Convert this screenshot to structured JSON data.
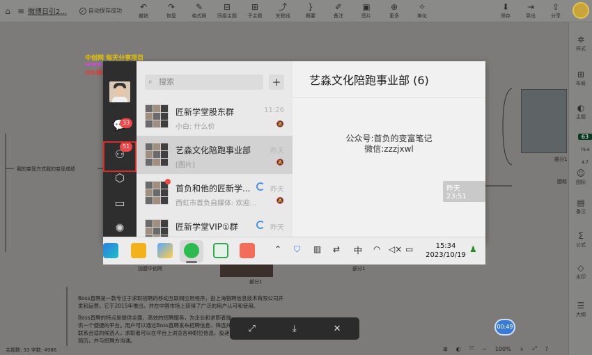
{
  "toolbar": {
    "doc_title": "微博日引2...",
    "autosave": "自动保存成功",
    "tools": [
      {
        "icon": "undo-icon",
        "glyph": "↶",
        "label": "撤销"
      },
      {
        "icon": "redo-icon",
        "glyph": "↷",
        "label": "恢复"
      },
      {
        "icon": "format-painter-icon",
        "glyph": "✎",
        "label": "格式刷"
      },
      {
        "icon": "sibling-topic-icon",
        "glyph": "⊟",
        "label": "同级主题"
      },
      {
        "icon": "child-topic-icon",
        "glyph": "⊞",
        "label": "子主题"
      },
      {
        "icon": "relation-line-icon",
        "glyph": "⤴",
        "label": "关联线"
      },
      {
        "icon": "summary-icon",
        "glyph": "}",
        "label": "概要"
      },
      {
        "icon": "note-icon",
        "glyph": "✐",
        "label": "备注"
      },
      {
        "icon": "image-icon",
        "glyph": "▣",
        "label": "图片"
      },
      {
        "icon": "more-icon",
        "glyph": "⊕",
        "label": "更多"
      },
      {
        "icon": "beautify-icon",
        "glyph": "✧",
        "label": "美化"
      }
    ],
    "right_tools": [
      {
        "icon": "save-icon",
        "glyph": "⬇",
        "label": "保存"
      },
      {
        "icon": "export-icon",
        "glyph": "⇥",
        "label": "导出"
      },
      {
        "icon": "share-icon",
        "glyph": "⇪",
        "label": "分享"
      }
    ]
  },
  "right_sidebar": [
    {
      "icon": "style-icon",
      "glyph": "✲",
      "label": "样式"
    },
    {
      "icon": "layout-icon",
      "glyph": "⊞",
      "label": "布局"
    },
    {
      "icon": "theme-icon",
      "glyph": "◐",
      "label": "主题"
    },
    {
      "icon": "icon-library-icon",
      "glyph": "☺",
      "label": "图标"
    },
    {
      "icon": "remark-icon",
      "glyph": "▤",
      "label": "备注"
    },
    {
      "icon": "formula-icon",
      "glyph": "Σ",
      "label": "公式"
    },
    {
      "icon": "watermark-icon",
      "glyph": "◇",
      "label": "水印"
    },
    {
      "icon": "outline-icon",
      "glyph": "☰",
      "label": "大纲"
    }
  ],
  "side_badges": [
    "63",
    "79.6",
    "4.7"
  ],
  "canvas": {
    "watermark_line1": "中创网 每天分享项目",
    "watermark_line2": "www.You85.com",
    "watermark_line3": "QQ/微信 723915236",
    "branch_left": "我的变现方式我的变现成绩",
    "label_part_right": "部分1",
    "label_add_chuang": "加盟中创网",
    "label_part_mid": "部分1",
    "label_part_bottom": "部分1",
    "icon_label": "图标",
    "boss_para1": "Boss直聘是一款专注于求职招聘的移动互联网应用程序，由上海猎聘信息技术有限公司开发和运营。它于2015年推出，并在中国市场上获得了广泛的用户认可和使用。",
    "boss_para2": "Boss直聘的特点是提供全面、高效的招聘服务，为企业和求职者提供一个便捷的平台。用户可以通过Boss直聘发布招聘信息、筛选并联系合适的候选人，求职者可以在平台上浏览各种职位信息、投递简历，并与招聘方沟通。"
  },
  "statusbar": {
    "text": "主题数: 33  字数: 4986",
    "zoom": "100%",
    "timer": "00:49"
  },
  "wechat": {
    "nav_badges": {
      "chats": "33",
      "contacts": "51"
    },
    "search_placeholder": "搜索",
    "chats": [
      {
        "name": "匠新学堂股东群",
        "preview": "小白: 什么价",
        "time": "11:26",
        "active": false
      },
      {
        "name": "艺淼文化陪跑事业部",
        "preview": "[图片]",
        "time": "昨天",
        "active": true
      },
      {
        "name": "首负和他的匠新学...",
        "preview": "西虹市首负自媒体: 欢迎...",
        "time": "昨天",
        "active": false
      },
      {
        "name": "匠新学堂VIP①群",
        "preview": "",
        "time": "昨天",
        "active": false
      }
    ],
    "chat_title": "艺淼文化陪跑事业部 (6)",
    "watermark_line1": "公众号:首负的变富笔记",
    "watermark_line2": "微信:zzzjxwl",
    "msg_time": "昨天 23:51"
  },
  "taskbar": {
    "ime": "中",
    "time": "15:34",
    "date": "2023/10/19"
  }
}
